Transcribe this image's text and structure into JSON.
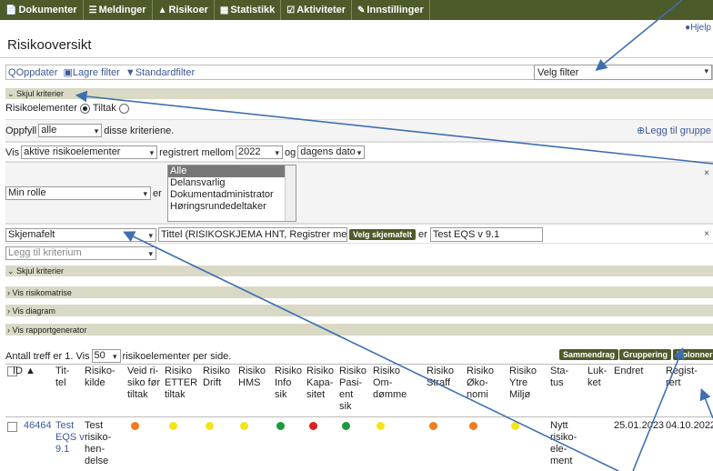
{
  "nav": {
    "items": [
      {
        "icon": "📄",
        "label": "Dokumenter"
      },
      {
        "icon": "☰",
        "label": "Meldinger"
      },
      {
        "icon": "▲",
        "label": "Risikoer"
      },
      {
        "icon": "▦",
        "label": "Statistikk"
      },
      {
        "icon": "☑",
        "label": "Aktiviteter"
      },
      {
        "icon": "✎",
        "label": "Innstillinger"
      }
    ]
  },
  "help_label": "Hjelp",
  "page_title": "Risikooversikt",
  "toolbar": {
    "update": "Oppdater",
    "save_filter": "Lagre filter",
    "standard_filter": "Standardfilter",
    "filter_select": "Velg filter"
  },
  "criteria": {
    "hide_label": "Skjul kriterier",
    "type_label": "Risikoelementer",
    "type_alt": "Tiltak",
    "fulfill_prefix": "Oppfyll",
    "fulfill_value": "alle",
    "fulfill_suffix": "disse kriteriene.",
    "add_group": "Legg til gruppe",
    "show_prefix": "Vis",
    "show_value": "aktive risikoelementer",
    "registered_between": "registrert mellom",
    "year_value": "2022",
    "and_label": "og",
    "date_value": "dagens dato",
    "role_value": "Min rolle",
    "is_label": "er",
    "role_options": [
      "Alle",
      "Delansvarlig",
      "Dokumentadministrator",
      "Høringsrundedeltaker"
    ],
    "schema_field_value": "Skjemafelt",
    "schema_title_text": "Tittel (RISIKOSKJEMA HNT, Registrer meldir",
    "choose_schema_field": "Velg skjemafelt",
    "is_label2": "er",
    "schema_value": "Test EQS v 9.1",
    "add_criterion_placeholder": "Legg til kriterium",
    "hide_label_bottom": "Skjul kriterier"
  },
  "sections": {
    "matrix": "Vis risikomatrise",
    "diagram": "Vis diagram",
    "report": "Vis rapportgenerator"
  },
  "results": {
    "prefix": "Antall treff er 1. Vis",
    "per_page": "50",
    "suffix": "risikoelementer per side.",
    "btn_summary": "Sammendrag",
    "btn_grouping": "Gruppering",
    "btn_columns": "Kolonner"
  },
  "table": {
    "headers": [
      "ID ▲",
      "Tit-\ntel",
      "Risiko-\nkilde",
      "Veid ri-\nsiko før\ntiltak",
      "Risiko\nETTER\ntiltak",
      "Risiko\nDrift",
      "Risiko\nHMS",
      "Risiko\nInfo\nsik",
      "Risiko\nKapa-\nsitet",
      "Risiko\nPasi-\nent\nsik",
      "Risiko\nOm-\ndømme",
      "Risiko\nStraff",
      "Risiko\nØko-\nnomi",
      "Risiko\nYtre\nMiljø",
      "Sta-\ntus",
      "Luk-\nket",
      "Endret",
      "Regist-\nrert"
    ],
    "row": {
      "id": "46464",
      "title": "Test\nEQS v\n9.1",
      "source": "Test\nrisiko-\nhen-\ndelse",
      "status": "Nytt\nrisiko-\nele-\nment",
      "changed": "25.01.2023",
      "registered": "04.10.2022",
      "dots": [
        "#f07d1c",
        "#f2e51a",
        "#f2e51a",
        "#f2e51a",
        "#1a9c3a",
        "#e01f1f",
        "#1a9c3a",
        "#f2e51a",
        "#f07d1c",
        "#f07d1c",
        "#f2e51a"
      ]
    }
  },
  "colors": {
    "nav_bg": "#4d5a2a",
    "bar_bg": "#d9d9c6",
    "link": "#3b5998",
    "arrow": "#3e6fb0"
  }
}
